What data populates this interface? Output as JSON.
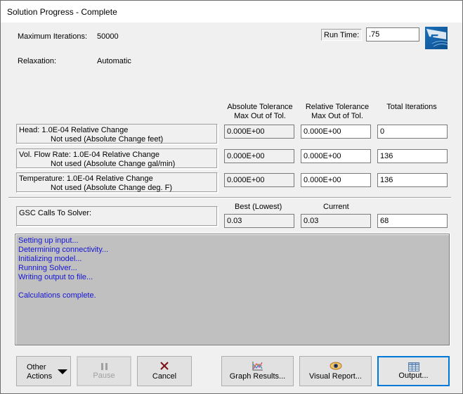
{
  "window": {
    "title": "Solution Progress - Complete"
  },
  "settings": {
    "max_iterations_label": "Maximum Iterations:",
    "max_iterations_value": "50000",
    "relaxation_label": "Relaxation:",
    "relaxation_value": "Automatic",
    "run_time_label": "Run Time:",
    "run_time_value": ".75",
    "logo_icon": "fathom-logo-icon"
  },
  "tolerance_table": {
    "headers": {
      "absolute": [
        "Absolute Tolerance",
        "Max Out of Tol."
      ],
      "relative": [
        "Relative Tolerance",
        "Max Out of Tol."
      ],
      "total": "Total Iterations"
    },
    "rows": [
      {
        "line1": "Head: 1.0E-04 Relative Change",
        "line2": "Not used (Absolute Change feet)",
        "absolute": "0.000E+00",
        "relative": "0.000E+00",
        "total": "0"
      },
      {
        "line1": "Vol. Flow Rate: 1.0E-04 Relative Change",
        "line2": "Not used (Absolute Change gal/min)",
        "absolute": "0.000E+00",
        "relative": "0.000E+00",
        "total": "136"
      },
      {
        "line1": "Temperature: 1.0E-04 Relative Change",
        "line2": "Not used (Absolute Change deg. F)",
        "absolute": "0.000E+00",
        "relative": "0.000E+00",
        "total": "136"
      }
    ]
  },
  "gsc": {
    "label": "GSC Calls To Solver:",
    "best_header": "Best (Lowest)",
    "current_header": "Current",
    "best_value": "0.03",
    "current_value": "0.03",
    "calls_value": "68"
  },
  "log": {
    "color": "#1515d5",
    "lines": [
      "Setting up input...",
      "Determining connectivity...",
      "Initializing model...",
      "Running Solver...",
      "Writing output to file...",
      "",
      "Calculations complete."
    ]
  },
  "buttons": {
    "other_actions": [
      "Other",
      "Actions"
    ],
    "pause": "Pause",
    "cancel": "Cancel",
    "graph_results": "Graph Results...",
    "visual_report": "Visual Report...",
    "output": "Output..."
  }
}
